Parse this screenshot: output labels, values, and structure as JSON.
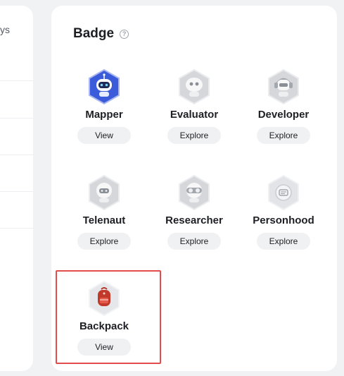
{
  "left_panel": {
    "fragment_text": "ys"
  },
  "badge_panel": {
    "title": "Badge",
    "help_icon": "question-circle-icon",
    "badges": [
      {
        "name": "Mapper",
        "button": "View",
        "state": "earned",
        "icon": "robot-blue-icon"
      },
      {
        "name": "Evaluator",
        "button": "Explore",
        "state": "locked",
        "icon": "robot-gray-icon"
      },
      {
        "name": "Developer",
        "button": "Explore",
        "state": "locked",
        "icon": "robot-headphones-icon"
      },
      {
        "name": "Telenaut",
        "button": "Explore",
        "state": "locked",
        "icon": "robot-gray-icon"
      },
      {
        "name": "Researcher",
        "button": "Explore",
        "state": "locked",
        "icon": "robot-goggles-icon"
      },
      {
        "name": "Personhood",
        "button": "Explore",
        "state": "locked",
        "icon": "id-card-icon"
      },
      {
        "name": "Backpack",
        "button": "View",
        "state": "earned",
        "icon": "backpack-red-icon"
      }
    ]
  },
  "colors": {
    "earned_blue": "#3b5bdb",
    "earned_red": "#c0392b",
    "highlight": "#e24c4c",
    "locked_gray": "#c9ccd1"
  }
}
